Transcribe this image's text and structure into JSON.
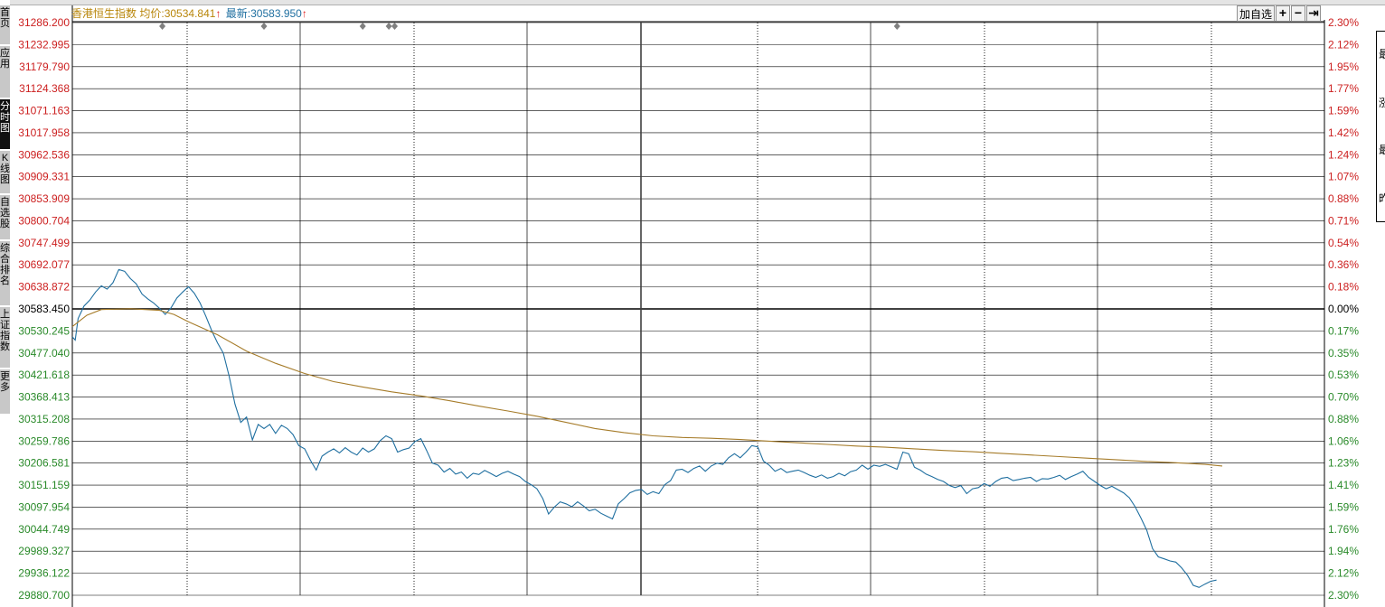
{
  "header": {
    "index_name": "香港恒生指数",
    "avg_label": "均价:",
    "avg_value": "30534.841",
    "last_label": "最新:",
    "last_value": "30583.950",
    "arrow": "↑"
  },
  "toolbar": {
    "add_watch": "加自选",
    "zoom_in_icon": "+",
    "zoom_out_icon": "−",
    "end_icon": "⇥"
  },
  "sidebar": {
    "items": [
      {
        "label": "首页",
        "active": false
      },
      {
        "label": "应用",
        "active": false
      },
      {
        "label": "分时图",
        "active": true
      },
      {
        "label": "K线图",
        "active": false
      },
      {
        "label": "自选股",
        "active": false
      },
      {
        "label": "综合排名",
        "active": false
      },
      {
        "label": "上证指数",
        "active": false
      },
      {
        "label": "更多",
        "active": false
      }
    ]
  },
  "right_panel": {
    "chars": [
      "最",
      "涨",
      "最",
      "昨"
    ]
  },
  "colors": {
    "up": "#cc2020",
    "down": "#2a8a2a",
    "neutral": "#000000",
    "price_line": "#1f6fa0",
    "avg_line": "#a67c2a",
    "grid": "#000000",
    "marker": "#808080"
  },
  "chart_data": {
    "type": "line",
    "title": "",
    "prev_close": 30583.45,
    "ylim": [
      29880.7,
      31286.2
    ],
    "price_ticks": [
      {
        "label": "31286.200",
        "dir": "up"
      },
      {
        "label": "31232.995",
        "dir": "up"
      },
      {
        "label": "31179.790",
        "dir": "up"
      },
      {
        "label": "31124.368",
        "dir": "up"
      },
      {
        "label": "31071.163",
        "dir": "up"
      },
      {
        "label": "31017.958",
        "dir": "up"
      },
      {
        "label": "30962.536",
        "dir": "up"
      },
      {
        "label": "30909.331",
        "dir": "up"
      },
      {
        "label": "30853.909",
        "dir": "up"
      },
      {
        "label": "30800.704",
        "dir": "up"
      },
      {
        "label": "30747.499",
        "dir": "up"
      },
      {
        "label": "30692.077",
        "dir": "up"
      },
      {
        "label": "30638.872",
        "dir": "up"
      },
      {
        "label": "30583.450",
        "dir": "neutral"
      },
      {
        "label": "30530.245",
        "dir": "down"
      },
      {
        "label": "30477.040",
        "dir": "down"
      },
      {
        "label": "30421.618",
        "dir": "down"
      },
      {
        "label": "30368.413",
        "dir": "down"
      },
      {
        "label": "30315.208",
        "dir": "down"
      },
      {
        "label": "30259.786",
        "dir": "down"
      },
      {
        "label": "30206.581",
        "dir": "down"
      },
      {
        "label": "30151.159",
        "dir": "down"
      },
      {
        "label": "30097.954",
        "dir": "down"
      },
      {
        "label": "30044.749",
        "dir": "down"
      },
      {
        "label": "29989.327",
        "dir": "down"
      },
      {
        "label": "29936.122",
        "dir": "down"
      },
      {
        "label": "29880.700",
        "dir": "down"
      }
    ],
    "pct_ticks": [
      {
        "label": "2.30%",
        "dir": "up"
      },
      {
        "label": "2.12%",
        "dir": "up"
      },
      {
        "label": "1.95%",
        "dir": "up"
      },
      {
        "label": "1.77%",
        "dir": "up"
      },
      {
        "label": "1.59%",
        "dir": "up"
      },
      {
        "label": "1.42%",
        "dir": "up"
      },
      {
        "label": "1.24%",
        "dir": "up"
      },
      {
        "label": "1.07%",
        "dir": "up"
      },
      {
        "label": "0.88%",
        "dir": "up"
      },
      {
        "label": "0.71%",
        "dir": "up"
      },
      {
        "label": "0.54%",
        "dir": "up"
      },
      {
        "label": "0.36%",
        "dir": "up"
      },
      {
        "label": "0.18%",
        "dir": "up"
      },
      {
        "label": "0.00%",
        "dir": "neutral"
      },
      {
        "label": "0.17%",
        "dir": "down"
      },
      {
        "label": "0.35%",
        "dir": "down"
      },
      {
        "label": "0.53%",
        "dir": "down"
      },
      {
        "label": "0.70%",
        "dir": "down"
      },
      {
        "label": "0.88%",
        "dir": "down"
      },
      {
        "label": "1.06%",
        "dir": "down"
      },
      {
        "label": "1.23%",
        "dir": "down"
      },
      {
        "label": "1.41%",
        "dir": "down"
      },
      {
        "label": "1.59%",
        "dir": "down"
      },
      {
        "label": "1.76%",
        "dir": "down"
      },
      {
        "label": "1.94%",
        "dir": "down"
      },
      {
        "label": "2.12%",
        "dir": "down"
      },
      {
        "label": "2.30%",
        "dir": "down"
      }
    ],
    "session_minutes": 330,
    "marker_minutes": [
      31,
      66,
      100,
      109,
      111,
      284
    ],
    "series": [
      {
        "key": "price",
        "points": [
          [
            0,
            30515
          ],
          [
            1,
            30507
          ],
          [
            2,
            30560
          ],
          [
            4,
            30590
          ],
          [
            6,
            30605
          ],
          [
            8,
            30625
          ],
          [
            10,
            30640
          ],
          [
            12,
            30632
          ],
          [
            14,
            30648
          ],
          [
            16,
            30680
          ],
          [
            18,
            30676
          ],
          [
            20,
            30658
          ],
          [
            22,
            30645
          ],
          [
            24,
            30620
          ],
          [
            26,
            30608
          ],
          [
            28,
            30598
          ],
          [
            30,
            30585
          ],
          [
            32,
            30570
          ],
          [
            34,
            30586
          ],
          [
            36,
            30610
          ],
          [
            38,
            30625
          ],
          [
            40,
            30638
          ],
          [
            42,
            30622
          ],
          [
            44,
            30598
          ],
          [
            46,
            30565
          ],
          [
            48,
            30530
          ],
          [
            50,
            30500
          ],
          [
            52,
            30475
          ],
          [
            54,
            30418
          ],
          [
            56,
            30350
          ],
          [
            58,
            30305
          ],
          [
            60,
            30318
          ],
          [
            62,
            30262
          ],
          [
            64,
            30300
          ],
          [
            66,
            30290
          ],
          [
            68,
            30300
          ],
          [
            70,
            30278
          ],
          [
            72,
            30298
          ],
          [
            74,
            30290
          ],
          [
            76,
            30275
          ],
          [
            78,
            30248
          ],
          [
            80,
            30240
          ],
          [
            82,
            30212
          ],
          [
            84,
            30188
          ],
          [
            86,
            30222
          ],
          [
            88,
            30232
          ],
          [
            90,
            30240
          ],
          [
            92,
            30230
          ],
          [
            94,
            30243
          ],
          [
            96,
            30232
          ],
          [
            98,
            30225
          ],
          [
            100,
            30242
          ],
          [
            102,
            30232
          ],
          [
            104,
            30240
          ],
          [
            106,
            30260
          ],
          [
            108,
            30272
          ],
          [
            110,
            30265
          ],
          [
            112,
            30232
          ],
          [
            114,
            30238
          ],
          [
            116,
            30242
          ],
          [
            118,
            30258
          ],
          [
            120,
            30265
          ],
          [
            122,
            30236
          ],
          [
            124,
            30205
          ],
          [
            126,
            30200
          ],
          [
            128,
            30183
          ],
          [
            130,
            30192
          ],
          [
            132,
            30178
          ],
          [
            134,
            30183
          ],
          [
            136,
            30168
          ],
          [
            138,
            30180
          ],
          [
            140,
            30177
          ],
          [
            142,
            30187
          ],
          [
            144,
            30180
          ],
          [
            146,
            30172
          ],
          [
            148,
            30180
          ],
          [
            150,
            30185
          ],
          [
            152,
            30178
          ],
          [
            154,
            30172
          ],
          [
            156,
            30160
          ],
          [
            158,
            30152
          ],
          [
            160,
            30142
          ],
          [
            162,
            30118
          ],
          [
            164,
            30080
          ],
          [
            166,
            30097
          ],
          [
            168,
            30110
          ],
          [
            170,
            30105
          ],
          [
            172,
            30098
          ],
          [
            174,
            30110
          ],
          [
            176,
            30100
          ],
          [
            178,
            30088
          ],
          [
            180,
            30092
          ],
          [
            182,
            30082
          ],
          [
            184,
            30075
          ],
          [
            186,
            30068
          ],
          [
            188,
            30105
          ],
          [
            190,
            30118
          ],
          [
            192,
            30132
          ],
          [
            194,
            30138
          ],
          [
            196,
            30140
          ],
          [
            198,
            30128
          ],
          [
            200,
            30135
          ],
          [
            202,
            30130
          ],
          [
            204,
            30152
          ],
          [
            206,
            30162
          ],
          [
            208,
            30188
          ],
          [
            210,
            30190
          ],
          [
            212,
            30182
          ],
          [
            214,
            30192
          ],
          [
            216,
            30198
          ],
          [
            218,
            30185
          ],
          [
            220,
            30198
          ],
          [
            222,
            30205
          ],
          [
            224,
            30202
          ],
          [
            226,
            30218
          ],
          [
            228,
            30228
          ],
          [
            230,
            30218
          ],
          [
            232,
            30232
          ],
          [
            234,
            30248
          ],
          [
            236,
            30245
          ],
          [
            238,
            30210
          ],
          [
            240,
            30200
          ],
          [
            242,
            30185
          ],
          [
            244,
            30192
          ],
          [
            246,
            30182
          ],
          [
            248,
            30185
          ],
          [
            250,
            30188
          ],
          [
            252,
            30182
          ],
          [
            254,
            30175
          ],
          [
            256,
            30170
          ],
          [
            258,
            30176
          ],
          [
            260,
            30168
          ],
          [
            262,
            30172
          ],
          [
            264,
            30180
          ],
          [
            266,
            30174
          ],
          [
            268,
            30184
          ],
          [
            270,
            30188
          ],
          [
            272,
            30200
          ],
          [
            274,
            30190
          ],
          [
            276,
            30200
          ],
          [
            278,
            30197
          ],
          [
            280,
            30202
          ],
          [
            282,
            30196
          ],
          [
            284,
            30190
          ],
          [
            286,
            30232
          ],
          [
            288,
            30228
          ],
          [
            290,
            30195
          ],
          [
            292,
            30188
          ],
          [
            294,
            30178
          ],
          [
            296,
            30172
          ],
          [
            298,
            30165
          ],
          [
            300,
            30160
          ],
          [
            302,
            30150
          ],
          [
            304,
            30145
          ],
          [
            306,
            30150
          ],
          [
            308,
            30130
          ],
          [
            310,
            30142
          ],
          [
            312,
            30145
          ],
          [
            314,
            30155
          ],
          [
            316,
            30148
          ],
          [
            318,
            30160
          ],
          [
            320,
            30168
          ],
          [
            322,
            30170
          ],
          [
            324,
            30162
          ],
          [
            326,
            30165
          ],
          [
            328,
            30168
          ],
          [
            330,
            30170
          ],
          [
            332,
            30160
          ],
          [
            334,
            30167
          ],
          [
            336,
            30166
          ],
          [
            338,
            30170
          ],
          [
            340,
            30175
          ],
          [
            342,
            30165
          ],
          [
            344,
            30172
          ],
          [
            346,
            30178
          ],
          [
            348,
            30185
          ],
          [
            350,
            30170
          ],
          [
            352,
            30160
          ],
          [
            354,
            30150
          ],
          [
            356,
            30142
          ],
          [
            358,
            30148
          ],
          [
            360,
            30140
          ],
          [
            362,
            30132
          ],
          [
            364,
            30120
          ],
          [
            366,
            30098
          ],
          [
            368,
            30070
          ],
          [
            370,
            30040
          ],
          [
            372,
            29995
          ],
          [
            374,
            29975
          ],
          [
            376,
            29970
          ],
          [
            378,
            29965
          ],
          [
            380,
            29962
          ],
          [
            382,
            29948
          ],
          [
            384,
            29930
          ],
          [
            386,
            29905
          ],
          [
            388,
            29900
          ],
          [
            390,
            29908
          ],
          [
            392,
            29915
          ],
          [
            394,
            29918
          ]
        ]
      },
      {
        "key": "avg",
        "points": [
          [
            0,
            30540
          ],
          [
            5,
            30568
          ],
          [
            10,
            30582
          ],
          [
            20,
            30584
          ],
          [
            30,
            30580
          ],
          [
            35,
            30570
          ],
          [
            40,
            30552
          ],
          [
            50,
            30520
          ],
          [
            60,
            30480
          ],
          [
            70,
            30450
          ],
          [
            80,
            30425
          ],
          [
            90,
            30405
          ],
          [
            100,
            30392
          ],
          [
            110,
            30380
          ],
          [
            120,
            30370
          ],
          [
            130,
            30358
          ],
          [
            140,
            30345
          ],
          [
            150,
            30333
          ],
          [
            160,
            30320
          ],
          [
            170,
            30305
          ],
          [
            180,
            30290
          ],
          [
            190,
            30280
          ],
          [
            200,
            30272
          ],
          [
            210,
            30268
          ],
          [
            220,
            30266
          ],
          [
            230,
            30263
          ],
          [
            240,
            30259
          ],
          [
            250,
            30255
          ],
          [
            260,
            30251
          ],
          [
            270,
            30247
          ],
          [
            280,
            30244
          ],
          [
            290,
            30240
          ],
          [
            300,
            30236
          ],
          [
            310,
            30233
          ],
          [
            320,
            30229
          ],
          [
            330,
            30225
          ],
          [
            340,
            30221
          ],
          [
            350,
            30217
          ],
          [
            360,
            30213
          ],
          [
            370,
            30209
          ],
          [
            380,
            30206
          ],
          [
            390,
            30202
          ],
          [
            396,
            30198
          ]
        ]
      }
    ]
  }
}
